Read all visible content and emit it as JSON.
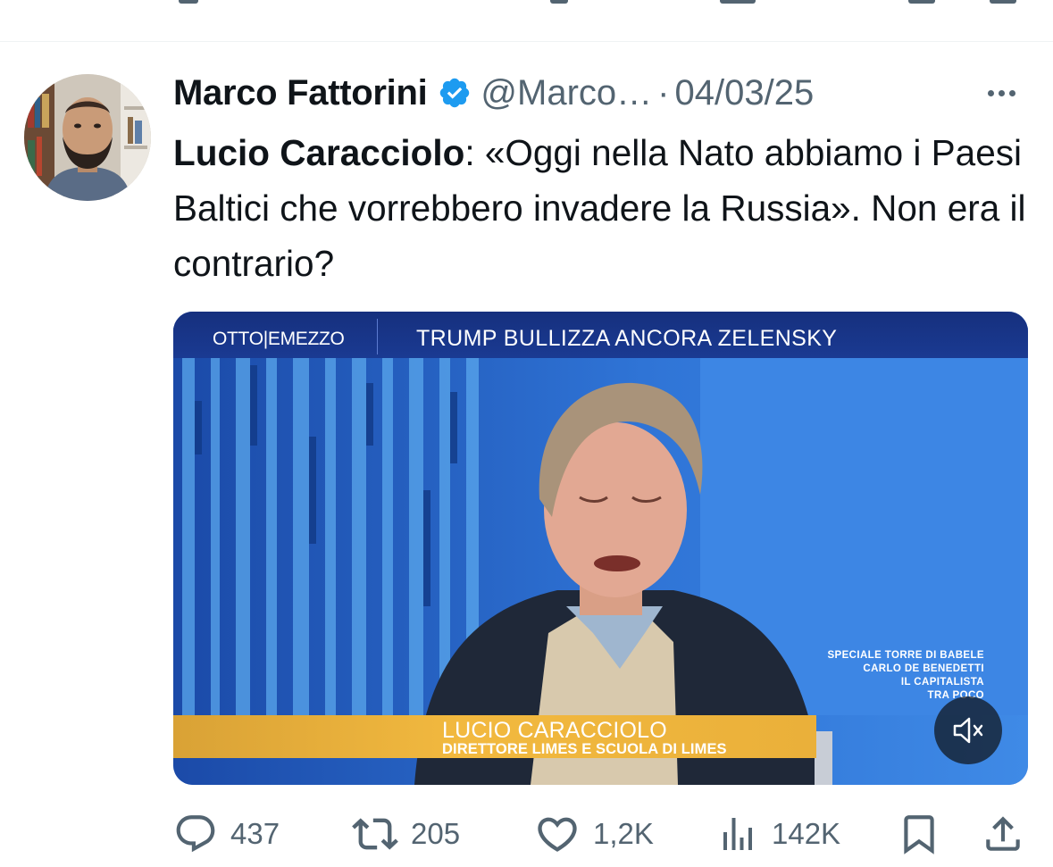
{
  "tweet": {
    "author": {
      "display_name": "Marco Fattorini",
      "handle": "@Marco…",
      "verified_icon": "verified-badge-icon",
      "avatar": "avatar"
    },
    "separator": "·",
    "date": "04/03/25",
    "text_bold": "Lucio Caracciolo",
    "text_rest": ": «Oggi nella Nato abbiamo i Paesi Baltici che vorrebbero invadere la Russia». Non era il contrario?",
    "media": {
      "channel_logo": "OTTO|EMEZZO",
      "headline": "TRUMP BULLIZZA ANCORA ZELENSKY",
      "side_promo": [
        "SPECIALE TORRE DI BABELE",
        "CARLO DE BENEDETTI",
        "IL CAPITALISTA",
        "TRA POCO"
      ],
      "lower_third_name": "LUCIO CARACCIOLO",
      "lower_third_role": "DIRETTORE LIMES E SCUOLA DI LIMES",
      "mute_icon": "volume-muted-icon"
    },
    "actions": {
      "replies": "437",
      "reposts": "205",
      "likes": "1,2K",
      "views": "142K",
      "bookmark_icon": "bookmark-icon",
      "share_icon": "share-icon"
    }
  },
  "colors": {
    "text_primary": "#0f1419",
    "text_secondary": "#536471",
    "verified_blue": "#1d9bf0",
    "divider": "#eff3f4",
    "tv_banner_gold": "#f2b93f",
    "tv_blue": "#1d4fb8"
  }
}
